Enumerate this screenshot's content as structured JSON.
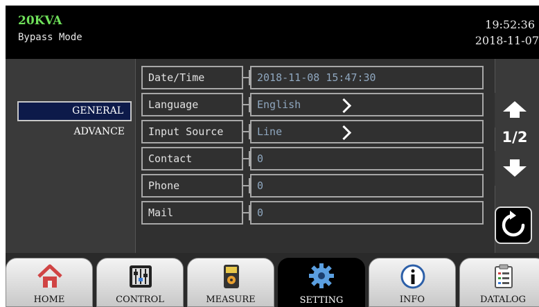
{
  "header": {
    "model": "20KVA",
    "mode": "Bypass Mode",
    "time": "19:52:36",
    "date": "2018-11-07"
  },
  "nav": {
    "general": "GENERAL",
    "advance": "ADVANCE"
  },
  "settings": [
    {
      "label": "Date/Time",
      "value": "2018-11-08 15:47:30",
      "has_chevron": false
    },
    {
      "label": "Language",
      "value": "English",
      "has_chevron": true
    },
    {
      "label": "Input Source",
      "value": "Line",
      "has_chevron": true
    },
    {
      "label": "Contact",
      "value": "0",
      "has_chevron": false
    },
    {
      "label": "Phone",
      "value": "0",
      "has_chevron": false
    },
    {
      "label": "Mail",
      "value": "0",
      "has_chevron": false
    }
  ],
  "pager": {
    "indicator": "1/2"
  },
  "tabs": [
    {
      "label": "HOME",
      "icon": "home-icon"
    },
    {
      "label": "CONTROL",
      "icon": "sliders-icon"
    },
    {
      "label": "MEASURE",
      "icon": "multimeter-icon"
    },
    {
      "label": "SETTING",
      "icon": "gear-icon"
    },
    {
      "label": "INFO",
      "icon": "info-icon"
    },
    {
      "label": "DATALOG",
      "icon": "clipboard-icon"
    }
  ],
  "colors": {
    "model_text": "#6fe05a",
    "value_text": "#8fa7bf",
    "nav_active": "#0d1a4a"
  }
}
